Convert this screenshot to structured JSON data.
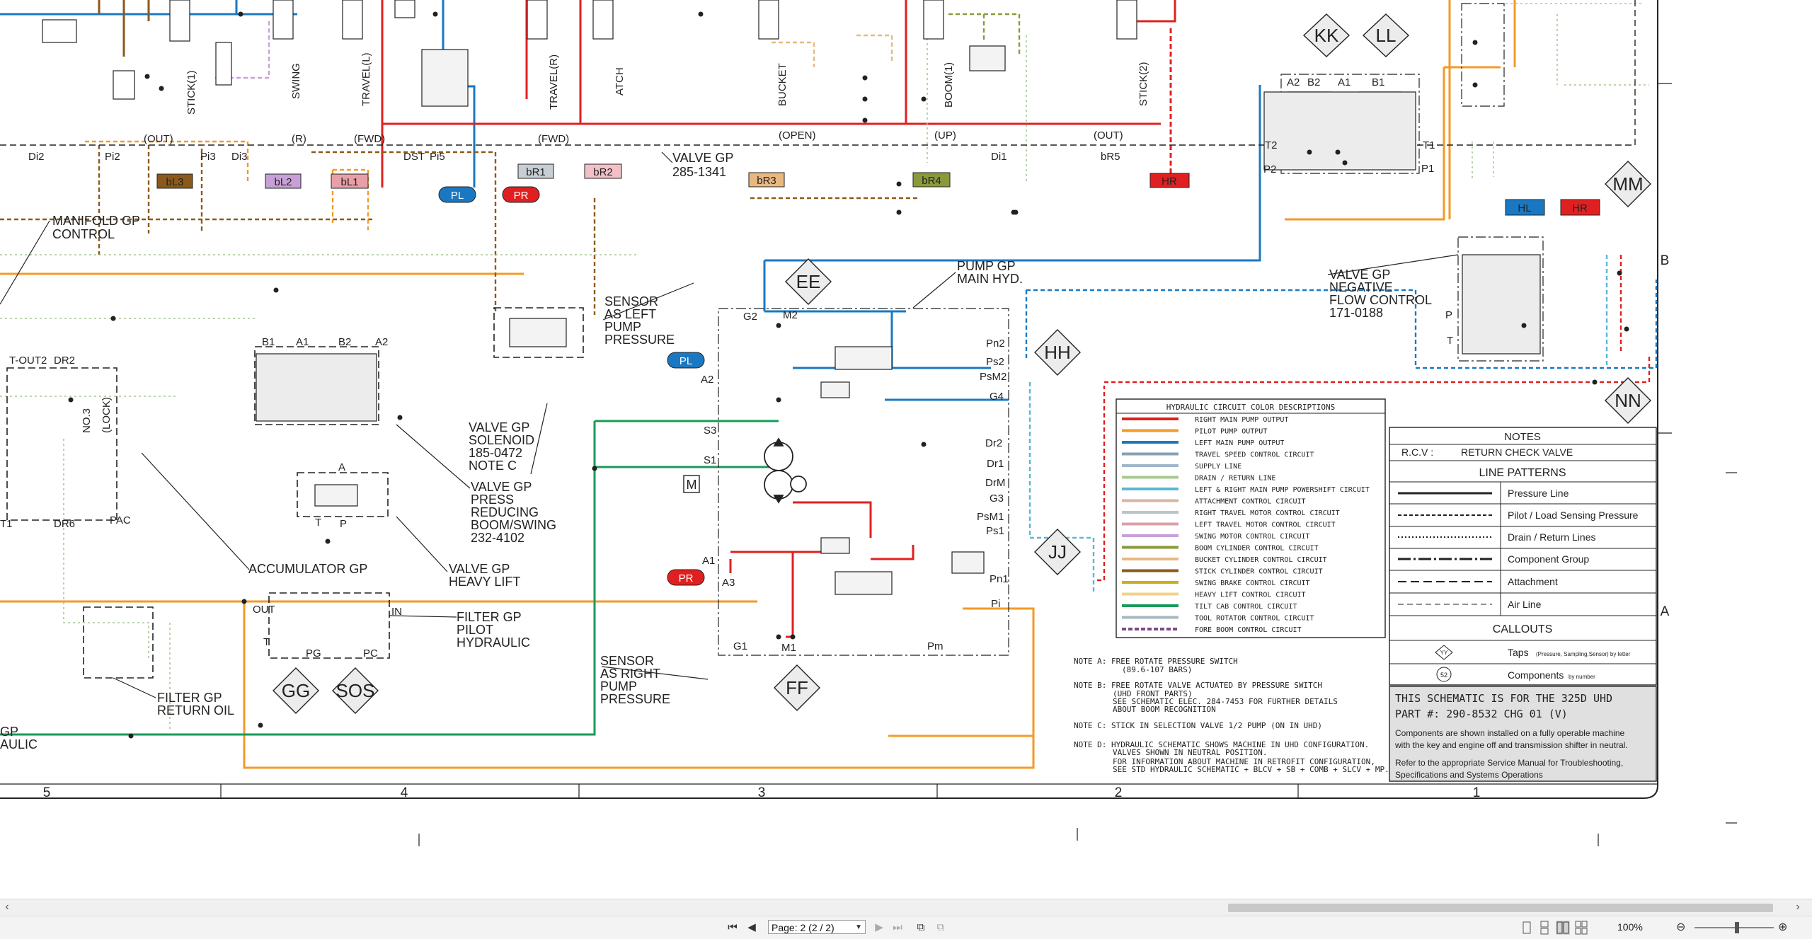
{
  "schematic": {
    "valve_labels": [
      "STICK(1)",
      "SWING",
      "TRAVEL(L)",
      "TRAVEL(R)",
      "ATCH",
      "BUCKET",
      "BOOM(1)",
      "STICK(2)"
    ],
    "row_texts": {
      "di2": "Di2",
      "pi2": "Pi2",
      "out1": "(OUT)",
      "pi3": "Pi3",
      "di3": "Di3",
      "r": "(R)",
      "fwd1": "(FWD)",
      "dst": "DST",
      "pi5": "Pi5",
      "fwd2": "(FWD)",
      "open": "(OPEN)",
      "up": "(UP)",
      "di1": "Di1",
      "out2": "(OUT)",
      "br5": "bR5"
    },
    "tags": {
      "bl3": "bL3",
      "bl2": "bL2",
      "bl1": "bL1",
      "pl": "PL",
      "pr": "PR",
      "br1": "bR1",
      "br2": "bR2",
      "br3": "bR3",
      "br4": "bR4",
      "hr": "HR",
      "hl": "HL",
      "hr2": "HR",
      "pl2": "PL",
      "pr2": "PR"
    },
    "valve_gp_main": [
      "VALVE GP",
      "285-1341"
    ],
    "manifold": [
      "MANIFOLD GP",
      "CONTROL"
    ],
    "sensor_left": [
      "SENSOR",
      "AS LEFT",
      "PUMP",
      "PRESSURE"
    ],
    "sensor_right": [
      "SENSOR",
      "AS RIGHT",
      "PUMP",
      "PRESSURE"
    ],
    "pump_gp": [
      "PUMP GP",
      "MAIN HYD."
    ],
    "valve_solenoid": [
      "VALVE GP",
      "SOLENOID",
      "185-0472",
      "NOTE C"
    ],
    "valve_reducing": [
      "VALVE GP",
      "PRESS",
      "REDUCING",
      "BOOM/SWING",
      "232-4102"
    ],
    "accumulator": "ACCUMULATOR GP",
    "heavy_lift": [
      "VALVE GP",
      "HEAVY LIFT"
    ],
    "filter_pilot": [
      "FILTER GP",
      "PILOT",
      "HYDRAULIC"
    ],
    "filter_return": [
      "FILTER GP",
      "RETURN OIL"
    ],
    "neg_flow": [
      "VALVE GP",
      "NEGATIVE",
      "FLOW CONTROL",
      "171-0188"
    ],
    "left_partial": [
      "GP",
      "AULIC"
    ],
    "taps": {
      "kk": "KK",
      "ll": "LL",
      "ee": "EE",
      "hh": "HH",
      "jj": "JJ",
      "ff": "FF",
      "gg": "GG",
      "sos": "SOS",
      "mm": "MM",
      "nn": "NN"
    },
    "ports": {
      "a2": "A2",
      "b2": "B2",
      "a1": "A1",
      "b1": "B1",
      "t2": "T2",
      "p2": "P2",
      "t1": "T1",
      "p1": "P1",
      "g2": "G2",
      "m2": "M2",
      "pn2": "Pn2",
      "ps2": "Ps2",
      "psm2": "PsM2",
      "g4": "G4",
      "s3": "S3",
      "s1": "S1",
      "dr2": "Dr2",
      "dr1": "Dr1",
      "drm": "DrM",
      "g3": "G3",
      "psm1": "PsM1",
      "ps1": "Ps1",
      "pn1": "Pn1",
      "pi": "Pi",
      "a1p": "A1",
      "a3": "A3",
      "g1": "G1",
      "m1": "M1",
      "pm": "Pm",
      "a2p": "A2",
      "tout2": "T-OUT2",
      "dr2l": "DR2",
      "no3": "NO.3",
      "lock": "(LOCK)",
      "pac": "PAC",
      "t1l": "T1",
      "dr6": "DR6",
      "out": "OUT",
      "in": "IN",
      "t": "T",
      "pg": "PG",
      "pc": "PC",
      "a": "A",
      "tp": "T",
      "p": "P",
      "b1n": "B1",
      "a1n": "A1",
      "a2n": "A2",
      "b2n": "B2",
      "pn": "P",
      "tn": "T"
    },
    "sensor_m": "M",
    "zone_numbers": [
      "5",
      "4",
      "3",
      "2",
      "1"
    ],
    "zone_letters": [
      "B",
      "A"
    ]
  },
  "legend": {
    "title": "HYDRAULIC CIRCUIT COLOR DESCRIPTIONS",
    "items": [
      {
        "color": "#e02020",
        "label": "RIGHT MAIN PUMP OUTPUT"
      },
      {
        "color": "#f39a27",
        "label": "PILOT PUMP OUTPUT"
      },
      {
        "color": "#1a78c2",
        "label": "LEFT MAIN PUMP OUTPUT"
      },
      {
        "color": "#8aa0b0",
        "label": "TRAVEL SPEED CONTROL CIRCUIT"
      },
      {
        "color": "#9fb7c9",
        "label": "SUPPLY LINE"
      },
      {
        "color": "#a8c890",
        "label": "DRAIN / RETURN LINE"
      },
      {
        "color": "#5ab6d6",
        "label": "LEFT & RIGHT MAIN PUMP POWERSHIFT CIRCUIT"
      },
      {
        "color": "#d8b4a0",
        "label": "ATTACHMENT CONTROL CIRCUIT"
      },
      {
        "color": "#b9c4c9",
        "label": "RIGHT TRAVEL MOTOR CONTROL CIRCUIT"
      },
      {
        "color": "#d9a0a8",
        "label": "LEFT TRAVEL MOTOR CONTROL CIRCUIT"
      },
      {
        "color": "#c8a0d8",
        "label": "SWING MOTOR CONTROL CIRCUIT"
      },
      {
        "color": "#8a9a3a",
        "label": "BOOM CYLINDER CONTROL CIRCUIT"
      },
      {
        "color": "#e8b880",
        "label": "BUCKET CYLINDER CONTROL CIRCUIT"
      },
      {
        "color": "#8b5a1a",
        "label": "STICK CYLINDER CONTROL CIRCUIT"
      },
      {
        "color": "#c8b020",
        "label": "SWING BRAKE CONTROL CIRCUIT"
      },
      {
        "color": "#f2d08a",
        "label": "HEAVY LIFT CONTROL CIRCUIT"
      },
      {
        "color": "#1a9a5a",
        "label": "TILT CAB CONTROL CIRCUIT"
      },
      {
        "color": "#a8b8c0",
        "label": "TOOL ROTATOR CONTROL CIRCUIT"
      },
      {
        "color": "#7a4a8a",
        "label": "FORE BOOM CONTROL CIRCUIT"
      }
    ]
  },
  "notes": {
    "title": "NOTES",
    "rcv_key": "R.C.V :",
    "rcv_val": "RETURN CHECK VALVE",
    "line_patterns_title": "LINE PATTERNS",
    "patterns": [
      "Pressure Line",
      "Pilot / Load Sensing Pressure",
      "Drain / Return Lines",
      "Component Group",
      "Attachment",
      "Air Line"
    ],
    "callouts_title": "CALLOUTS",
    "callout_taps_main": "Taps",
    "callout_taps_sub": "(Pressure, Sampling,Sensor) by letter",
    "callout_comp_main": "Components",
    "callout_comp_sub": "by number",
    "yy": "YY",
    "num52": "52"
  },
  "title_block": {
    "line1": "THIS SCHEMATIC IS FOR THE 325D UHD",
    "line2": "PART #: 290-8532 CHG 01 (V)",
    "p1a": "Components are shown installed on a fully operable machine",
    "p1b": "with the key and engine off and transmission shifter in neutral.",
    "p2a": "Refer to the appropriate Service Manual for Troubleshooting,",
    "p2b": "Specifications and Systems Operations"
  },
  "notes_text": {
    "a1": "NOTE A: FREE ROTATE PRESSURE SWITCH",
    "a2": "(89.6-107 BARS)",
    "b1": "NOTE B: FREE ROTATE VALVE ACTUATED BY PRESSURE SWITCH",
    "b2": "(UHD FRONT PARTS)",
    "b3": "SEE SCHEMATIC ELEC. 284-7453 FOR FURTHER DETAILS",
    "b4": "ABOUT BOOM RECOGNITION",
    "c1": "NOTE C: STICK IN SELECTION VALVE 1/2 PUMP (ON IN UHD)",
    "d1": "NOTE D: HYDRAULIC SCHEMATIC SHOWS MACHINE IN UHD CONFIGURATION.",
    "d2": "VALVES SHOWN IN NEUTRAL POSITION.",
    "d3": "FOR INFORMATION ABOUT MACHINE IN RETROFIT CONFIGURATION,",
    "d4": "SEE STD HYDRAULIC SCHEMATIC + BLCV + SB + COMB + SLCV + MP."
  },
  "statusbar": {
    "page_label": "Page: 2 (2 / 2)",
    "zoom": "100%",
    "colors": {
      "accent": "#1a78c2"
    }
  }
}
